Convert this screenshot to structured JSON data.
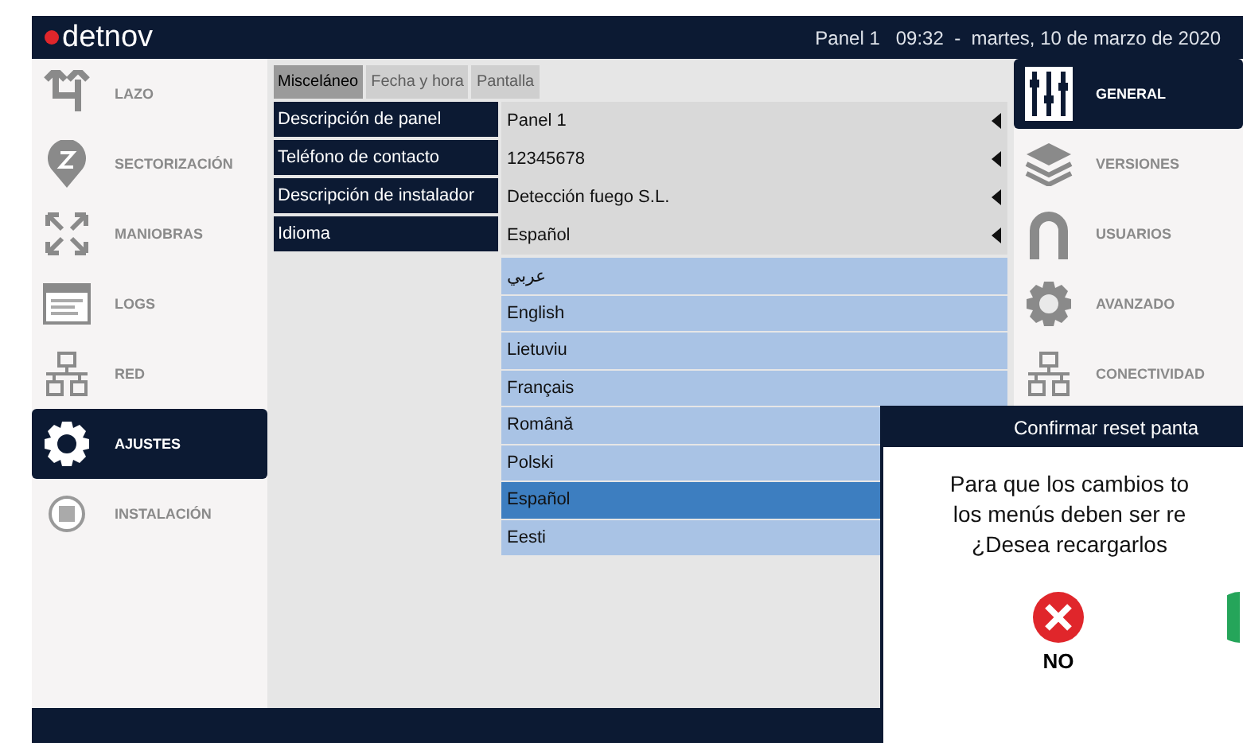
{
  "header": {
    "logo": "detnov",
    "status": "Panel 1   09:32  -  martes, 10 de marzo de 2020"
  },
  "sidebar": {
    "items": [
      {
        "label": "LAZO",
        "kind": "loop",
        "selected": false
      },
      {
        "label": "SECTORIZACIÓN",
        "kind": "zone",
        "selected": false
      },
      {
        "label": "MANIOBRAS",
        "kind": "arrows",
        "selected": false
      },
      {
        "label": "LOGS",
        "kind": "log",
        "selected": false
      },
      {
        "label": "RED",
        "kind": "network",
        "selected": false
      },
      {
        "label": "AJUSTES",
        "kind": "gear",
        "selected": true
      },
      {
        "label": "INSTALACIÓN",
        "kind": "install",
        "selected": false
      }
    ]
  },
  "tabs": [
    {
      "label": "Misceláneo",
      "selected": true
    },
    {
      "label": "Fecha y hora",
      "selected": false
    },
    {
      "label": "Pantalla",
      "selected": false
    }
  ],
  "fields": [
    {
      "label": "Descripción de panel",
      "value": "Panel 1"
    },
    {
      "label": "Teléfono de contacto",
      "value": "12345678"
    },
    {
      "label": "Descripción de instalador",
      "value": "Detección fuego S.L."
    },
    {
      "label": "Idioma",
      "value": "Español"
    }
  ],
  "language_list": [
    {
      "label": "عربي",
      "selected": false
    },
    {
      "label": "English",
      "selected": false
    },
    {
      "label": "Lietuviu",
      "selected": false
    },
    {
      "label": "Français",
      "selected": false
    },
    {
      "label": "Română",
      "selected": false
    },
    {
      "label": "Polski",
      "selected": false
    },
    {
      "label": "Español",
      "selected": true
    },
    {
      "label": "Eesti",
      "selected": false
    }
  ],
  "settings_menu": {
    "items": [
      {
        "label": "GENERAL",
        "kind": "sliders",
        "selected": true
      },
      {
        "label": "VERSIONES",
        "kind": "layers",
        "selected": false
      },
      {
        "label": "USUARIOS",
        "kind": "user",
        "selected": false
      },
      {
        "label": "AVANZADO",
        "kind": "cog",
        "selected": false
      },
      {
        "label": "CONECTIVIDAD",
        "kind": "network",
        "selected": false
      }
    ]
  },
  "dialog": {
    "title": "Confirmar reset panta",
    "message": [
      "Para que los cambios to",
      "los menús deben ser re",
      "¿Desea recargarlos"
    ],
    "buttons": [
      {
        "label": "NO",
        "kind": "no"
      },
      {
        "kind": "yes"
      }
    ]
  }
}
